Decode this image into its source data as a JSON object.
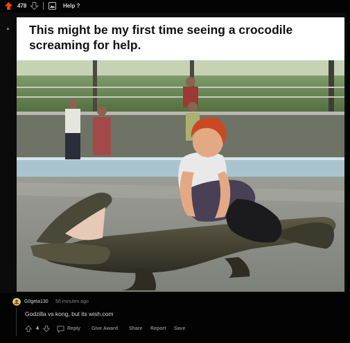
{
  "post": {
    "score": "478",
    "title": "Help ?",
    "caption": "This might be my first time seeing a crocodile screaming for help.",
    "upvote_color": "#ff4500"
  },
  "comment": {
    "username": "G0geta130",
    "timestamp": "56 minutes ago",
    "body": "Godzilla vs kong, but its wish.com",
    "score": "4",
    "actions": {
      "reply": "Reply",
      "give_award": "Give Award",
      "share": "Share",
      "report": "Report",
      "save": "Save"
    }
  },
  "icons": [
    "upvote-icon",
    "downvote-icon",
    "post-image-icon",
    "reply-icon",
    "avatar"
  ]
}
